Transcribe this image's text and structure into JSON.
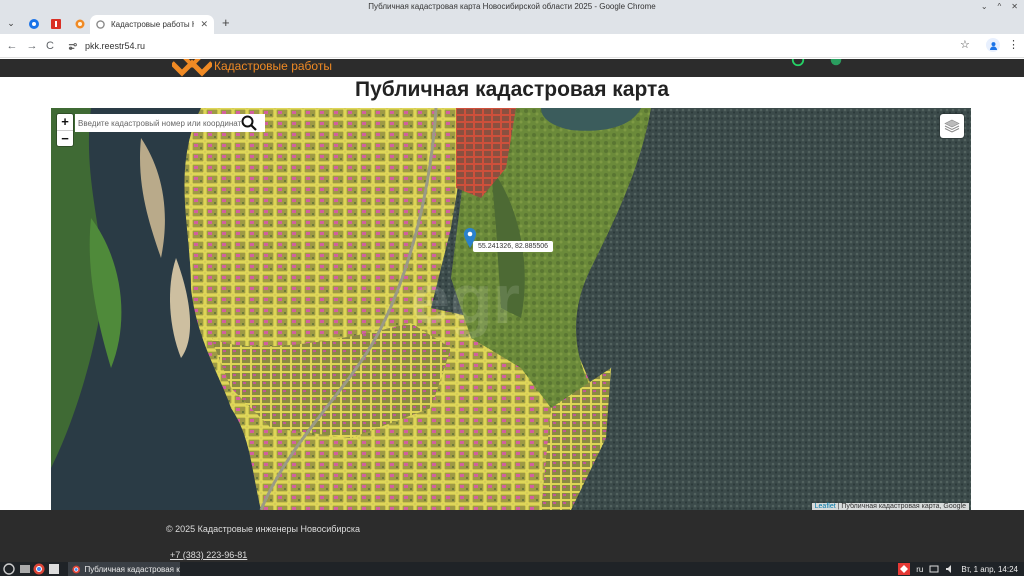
{
  "window": {
    "title": "Публичная кадастровая карта Новосибирской области 2025 - Google Chrome",
    "minimize": "⌄",
    "maximize": "^",
    "close": "✕"
  },
  "tabs": {
    "active_title": "Кадастровые работы Новосиб...",
    "close": "✕",
    "new_tab": "+",
    "dropdown": "⌄"
  },
  "toolbar": {
    "back": "←",
    "forward": "→",
    "reload": "C",
    "url": "pkk.reestr54.ru",
    "bookmark": "☆",
    "menu": "⋮"
  },
  "site": {
    "name": "Кадастровые работы",
    "accent_color": "#f08a24"
  },
  "page": {
    "title": "Публичная кадастровая карта"
  },
  "map": {
    "zoom_in": "+",
    "zoom_out": "−",
    "search_placeholder": "Введите кадастровый номер или координаты",
    "popup": "55.241326, 82.885506",
    "attribution_link": "Leaflet",
    "attribution_text": " | Публичная кадастровая карта, Google"
  },
  "footer": {
    "copyright": "© 2025 Кадастровые инженеры Новосибирска",
    "phone": "+7 (383) 223-96-81"
  },
  "taskbar": {
    "task_title": "Публичная кадастровая к...",
    "lang": "ru",
    "clock": "Вт, 1 апр, 14:24"
  }
}
